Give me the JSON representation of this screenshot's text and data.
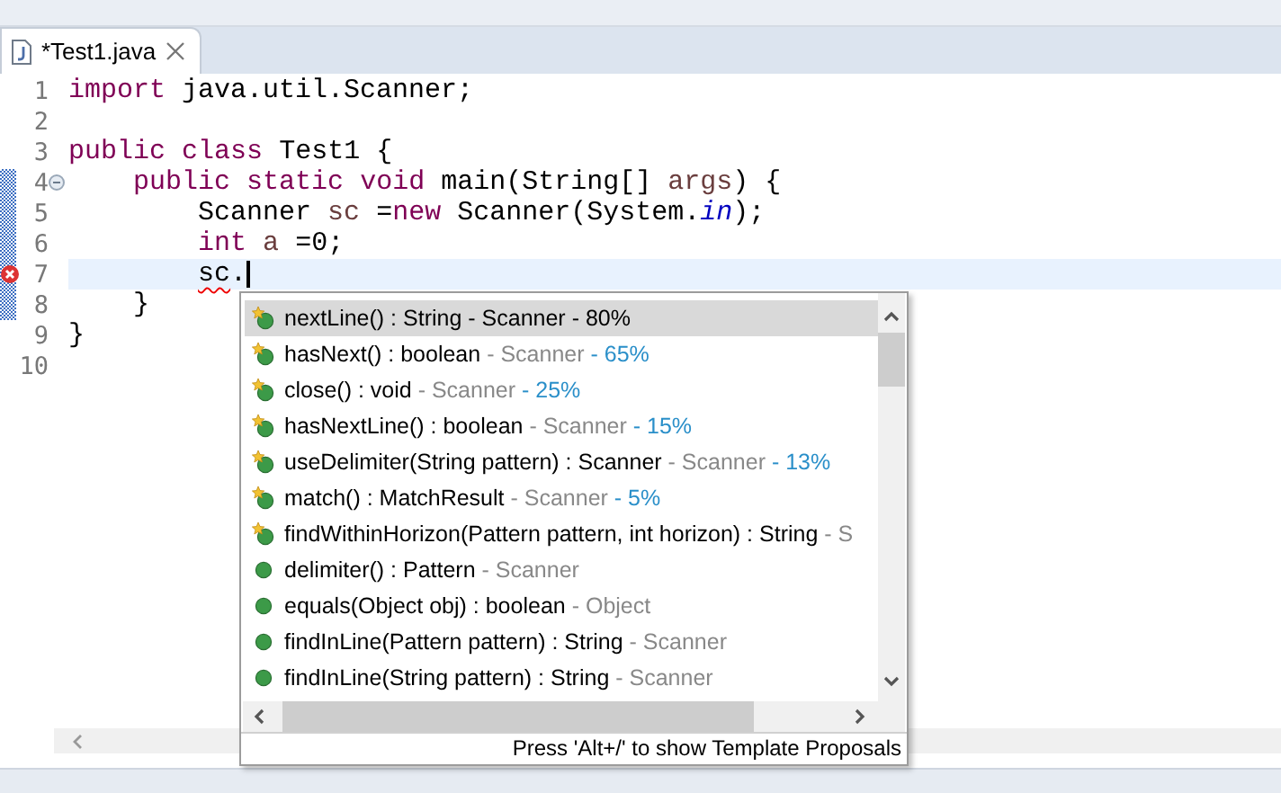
{
  "editor_tab": {
    "title": "*Test1.java",
    "selected": true
  },
  "lines": [
    {
      "number": "1",
      "tokens": [
        {
          "kind": "keyword",
          "text": "import"
        },
        {
          "kind": "plain",
          "text": " java.util.Scanner;"
        }
      ]
    },
    {
      "number": "2"
    },
    {
      "number": "3",
      "tokens": [
        {
          "kind": "keyword",
          "text": "public"
        },
        {
          "kind": "keyword",
          "text": " class"
        },
        {
          "kind": "plain",
          "text": " Test1 {"
        }
      ]
    },
    {
      "number": "4",
      "folding": true,
      "tokens": [
        {
          "kind": "keyword",
          "text": "    public"
        },
        {
          "kind": "keyword",
          "text": " static"
        },
        {
          "kind": "keyword",
          "text": " void"
        },
        {
          "kind": "plain",
          "text": " main(String[] "
        },
        {
          "kind": "variable",
          "text": "args"
        },
        {
          "kind": "plain",
          "text": ") {"
        }
      ]
    },
    {
      "number": "5",
      "tokens": [
        {
          "kind": "plain",
          "text": "        Scanner "
        },
        {
          "kind": "variable",
          "text": "sc"
        },
        {
          "kind": "plain",
          "text": " ="
        },
        {
          "kind": "keyword",
          "text": "new"
        },
        {
          "kind": "plain",
          "text": " Scanner(System."
        },
        {
          "kind": "field",
          "text": "in"
        },
        {
          "kind": "plain",
          "text": ");"
        }
      ]
    },
    {
      "number": "6",
      "tokens": [
        {
          "kind": "keyword",
          "text": "        int"
        },
        {
          "kind": "variable",
          "text": " a"
        },
        {
          "kind": "plain",
          "text": " =0;"
        }
      ]
    },
    {
      "number": "7",
      "error": true,
      "current": true,
      "tokens": [
        {
          "kind": "error",
          "text": "        sc"
        },
        {
          "kind": "plain",
          "text": "."
        }
      ]
    },
    {
      "number": "8",
      "tokens": [
        {
          "kind": "plain",
          "text": "    }"
        }
      ]
    },
    {
      "number": "9",
      "tokens": [
        {
          "kind": "plain",
          "text": "}"
        }
      ]
    },
    {
      "number": "10"
    }
  ],
  "proposals": [
    {
      "kind": "recommended",
      "selected": true,
      "signature": "nextLine() : String",
      "qualifier": "- Scanner",
      "relevance": "- 80%"
    },
    {
      "kind": "recommended",
      "selected": false,
      "signature": "hasNext() : boolean",
      "qualifier": "- Scanner",
      "relevance": "- 65%"
    },
    {
      "kind": "recommended",
      "selected": false,
      "signature": "close() : void",
      "qualifier": "- Scanner",
      "relevance": "- 25%"
    },
    {
      "kind": "recommended",
      "selected": false,
      "signature": "hasNextLine() : boolean",
      "qualifier": "- Scanner",
      "relevance": "- 15%"
    },
    {
      "kind": "recommended",
      "selected": false,
      "signature": "useDelimiter(String pattern) : Scanner",
      "qualifier": "- Scanner",
      "relevance": "- 13%"
    },
    {
      "kind": "recommended",
      "selected": false,
      "signature": "match() : MatchResult",
      "qualifier": "- Scanner",
      "relevance": "- 5%"
    },
    {
      "kind": "recommended",
      "selected": false,
      "signature": "findWithinHorizon(Pattern pattern, int horizon) : String",
      "qualifier": "- S"
    },
    {
      "kind": "method",
      "selected": false,
      "signature": "delimiter() : Pattern",
      "qualifier": "- Scanner"
    },
    {
      "kind": "method",
      "selected": false,
      "signature": "equals(Object obj) : boolean",
      "qualifier": "- Object"
    },
    {
      "kind": "method",
      "selected": false,
      "signature": "findInLine(Pattern pattern) : String",
      "qualifier": "- Scanner"
    },
    {
      "kind": "method",
      "selected": false,
      "signature": "findInLine(String pattern) : String",
      "qualifier": "- Scanner"
    }
  ],
  "popup_hint": "Press 'Alt+/' to show Template Proposals"
}
